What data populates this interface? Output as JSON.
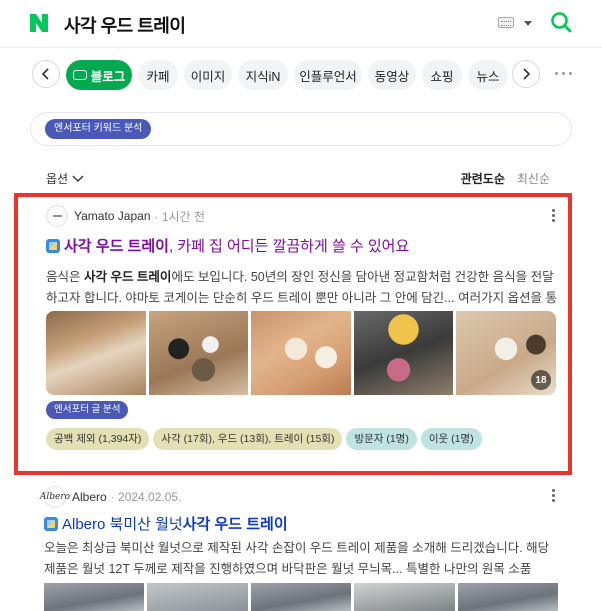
{
  "header": {
    "query": "사각 우드 트레이",
    "logo_icon": "naver-n-logo",
    "brand_color": "#03c75a"
  },
  "tabs": [
    "블로그",
    "카페",
    "이미지",
    "지식iN",
    "인플루언서",
    "동영상",
    "쇼핑",
    "뉴스"
  ],
  "active_tab": "블로그",
  "analysis_pill": {
    "label": "엔서포터 키워드 분석"
  },
  "options": {
    "label": "옵션"
  },
  "sort": {
    "relevance": "관련도순",
    "recent": "최신순"
  },
  "result1": {
    "source": "Yamato Japan",
    "time": "1시간 전",
    "title_bold": "사각 우드 트레이",
    "title_rest": ", 카페 집 어디든 깔끔하게 쓸 수 있어요",
    "snippet_pre": "음식은 ",
    "snippet_bold": "사각 우드 트레이",
    "snippet_post": "에도 보입니다. 50년의 장인 정신을 담아낸 정교함처럼 건강한 음식을 전달하고자 합니다. 야마토 코게이는 단순히 우드 트레이 뿐만 아니라 그 안에 담긴... 여러가지 옵션을 통해서 원...",
    "image_count": "18",
    "analysis_label": "엔서포터 글 분석",
    "chips": [
      {
        "label": "공백 제외 (1,394자)",
        "tone": "y"
      },
      {
        "label": "사각 (17회), 우드 (13회), 트레이 (15회)",
        "tone": "y"
      },
      {
        "label": "방문자 (1명)",
        "tone": "c"
      },
      {
        "label": "이웃 (1명)",
        "tone": "c"
      }
    ]
  },
  "result2": {
    "source": "Albero",
    "date": "2024.02.05.",
    "avatar_text": "Albero",
    "title_plain": "Albero 북미산 월넛 ",
    "title_bold": "사각 우드 트레이",
    "snippet": "오늘은 최상급 북미산 월넛으로 제작된 사각 손잡이 우드 트레이 제품을 소개해 드리겠습니다. 해당 제품은 월넛 12T 두께로 제작을 진행하였으며 바닥판은 월넛 무늬목... 특별한 나만의 원목 소품 Albero에서..."
  },
  "highlight_color": "#e8362a"
}
